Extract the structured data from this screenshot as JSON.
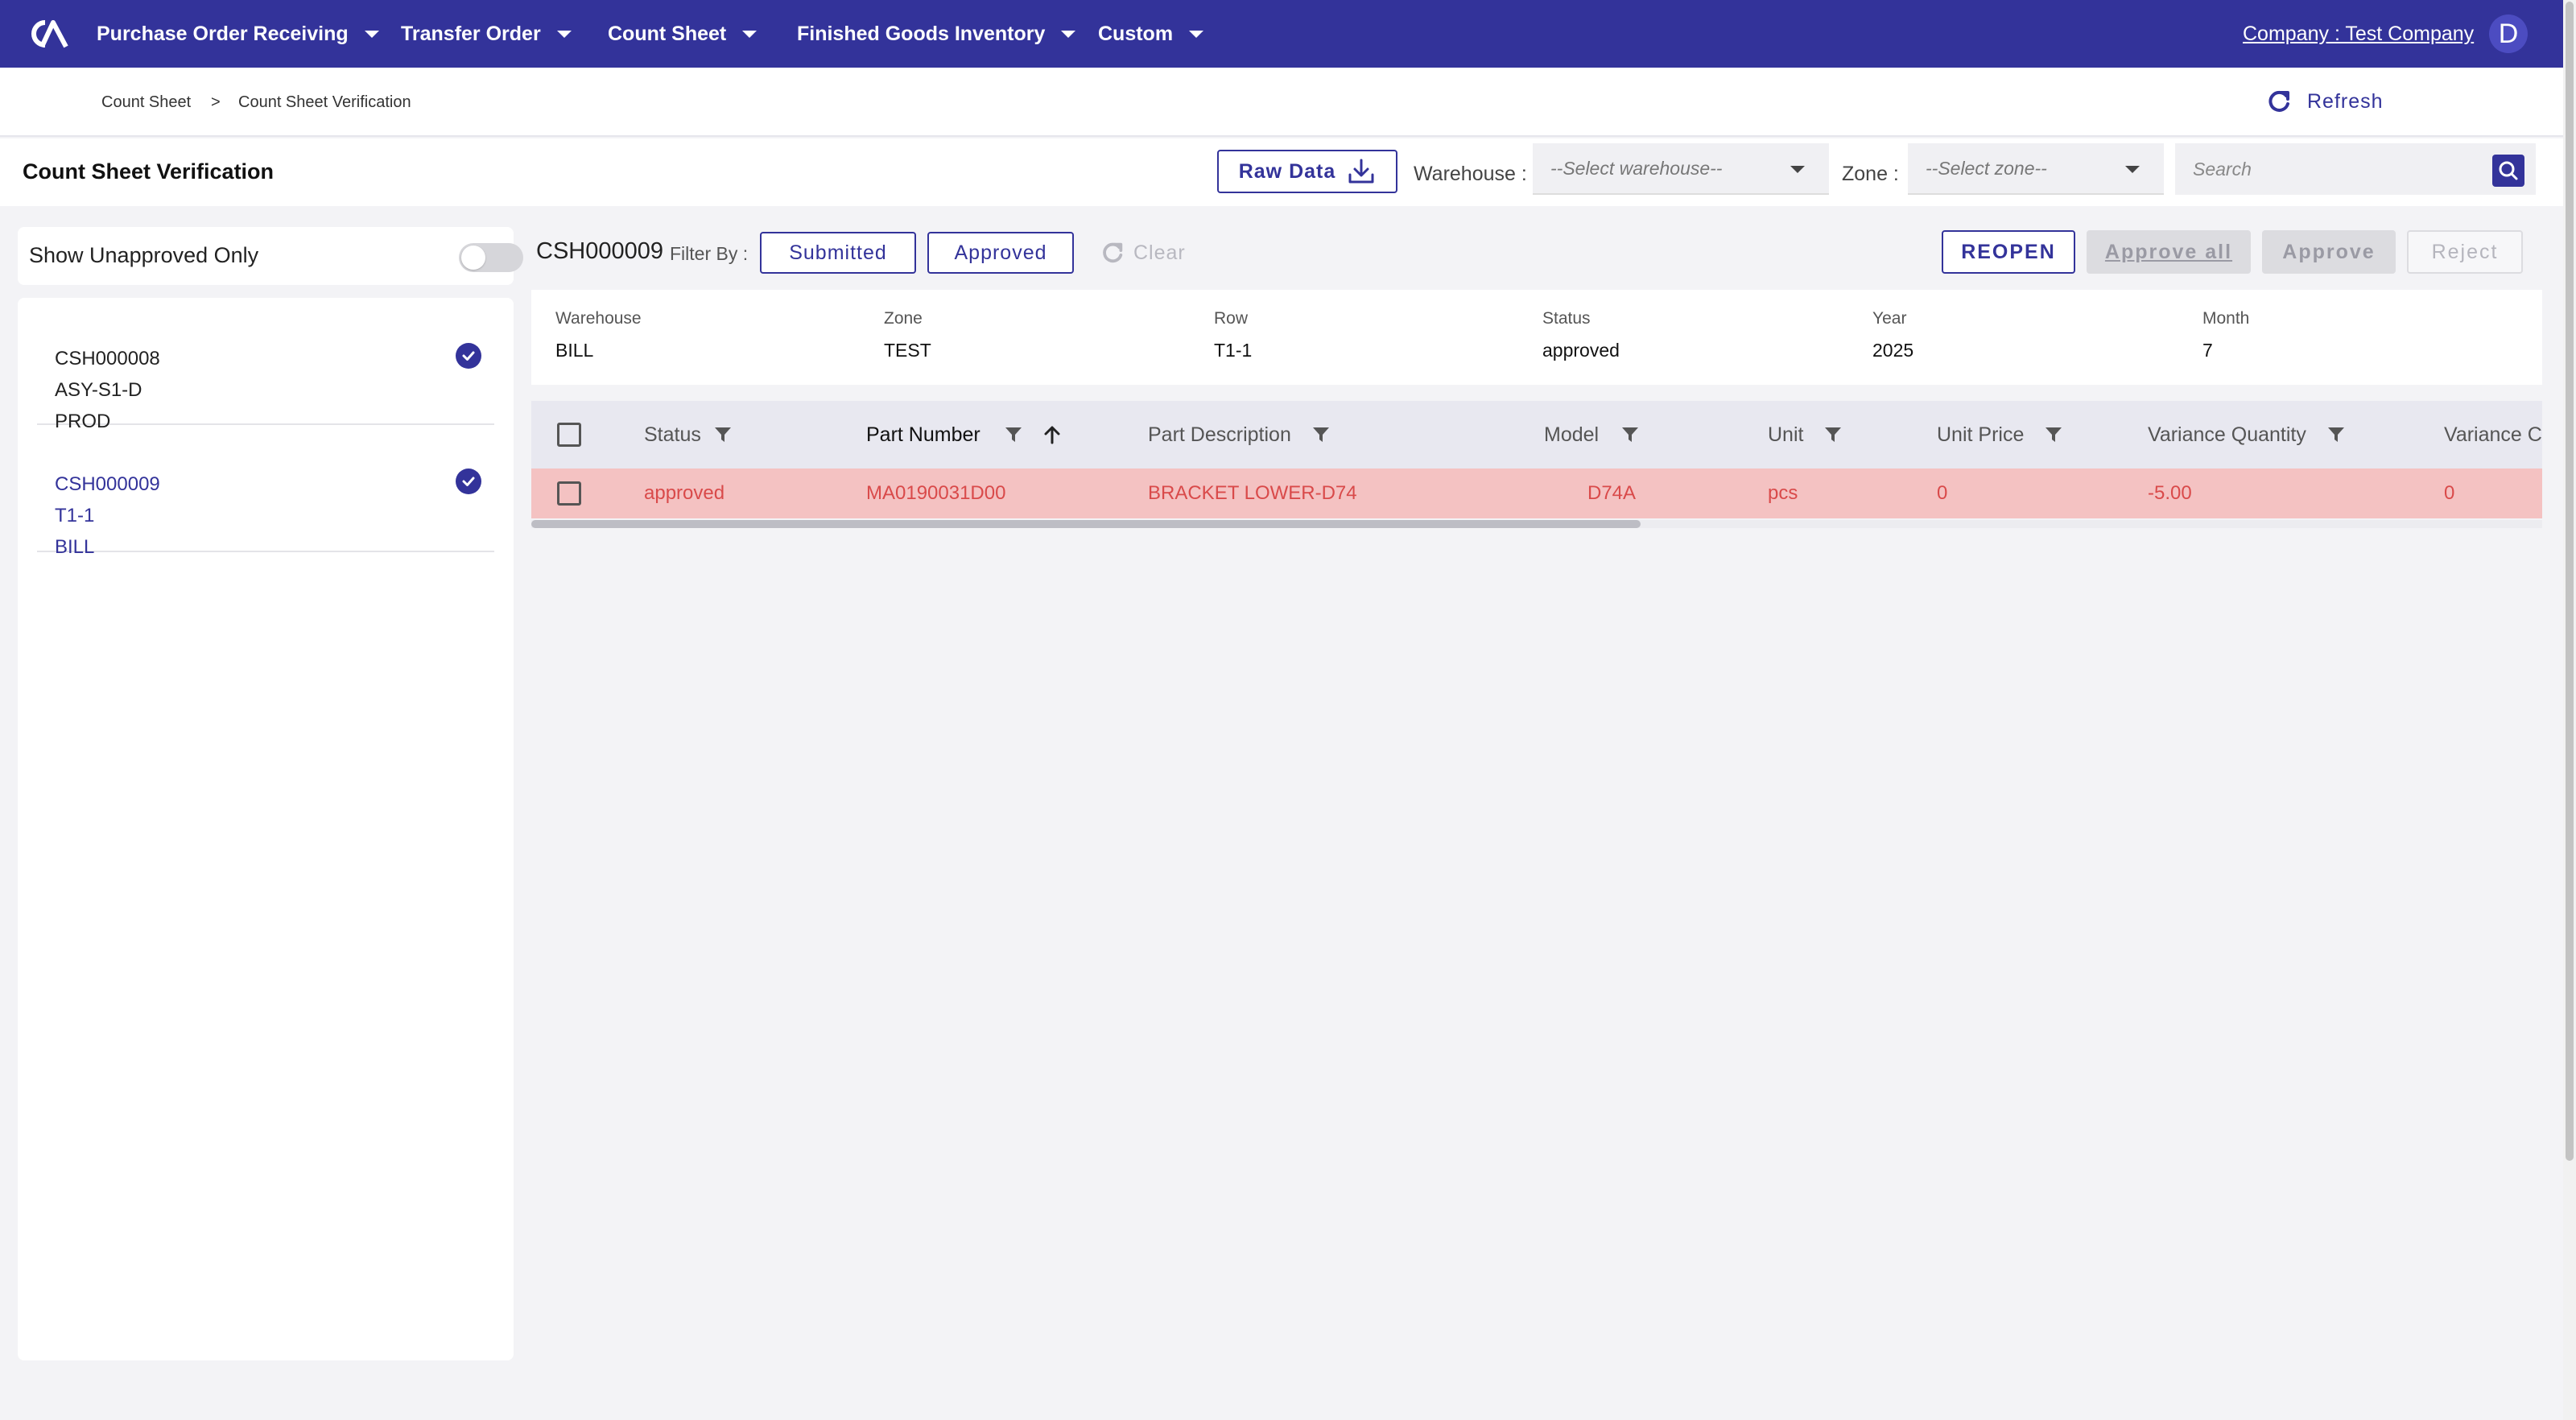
{
  "nav": {
    "items": [
      "Purchase Order Receiving",
      "Transfer Order",
      "Count Sheet",
      "Finished Goods Inventory",
      "Custom"
    ],
    "company": "Company : Test Company",
    "avatar_initial": "D",
    "brand_color": "#33339a"
  },
  "breadcrumb": {
    "first": "Count Sheet",
    "separator": ">",
    "current": "Count Sheet Verification"
  },
  "refresh_label": "Refresh",
  "page_title": "Count Sheet Verification",
  "toolbar": {
    "raw_data_label": "Raw Data",
    "warehouse_label": "Warehouse :",
    "warehouse_placeholder": "--Select warehouse--",
    "zone_label": "Zone :",
    "zone_placeholder": "--Select zone--",
    "search_placeholder": "Search"
  },
  "sidebar": {
    "toggle_label": "Show Unapproved Only",
    "toggle_on": false,
    "sheets": [
      {
        "id": "CSH000008",
        "row": "ASY-S1-D",
        "warehouse": "PROD",
        "checked": true,
        "active": false
      },
      {
        "id": "CSH000009",
        "row": "T1-1",
        "warehouse": "BILL",
        "checked": true,
        "active": true
      }
    ]
  },
  "detail": {
    "sheet_id": "CSH000009",
    "filter_by_label": "Filter By :",
    "filter_submitted": "Submitted",
    "filter_approved": "Approved",
    "clear_label": "Clear",
    "reopen_label": "REOPEN",
    "approve_all_label": "Approve all",
    "approve_label": "Approve",
    "reject_label": "Reject",
    "info": {
      "warehouse_key": "Warehouse",
      "warehouse": "BILL",
      "zone_key": "Zone",
      "zone": "TEST",
      "row_key": "Row",
      "row": "T1-1",
      "status_key": "Status",
      "status": "approved",
      "year_key": "Year",
      "year": "2025",
      "month_key": "Month",
      "month": "7"
    }
  },
  "table": {
    "headers": {
      "status": "Status",
      "part_number": "Part Number",
      "part_description": "Part Description",
      "model": "Model",
      "unit": "Unit",
      "unit_price": "Unit Price",
      "variance_quantity": "Variance Quantity",
      "variance_cost": "Variance Co"
    },
    "rows": [
      {
        "status": "approved",
        "part_number": "MA0190031D00",
        "part_description": "BRACKET LOWER-D74",
        "model": "D74A",
        "unit": "pcs",
        "unit_price": "0",
        "variance_quantity": "-5.00",
        "variance_cost": "0"
      }
    ],
    "row_color": "#f4c2c2",
    "row_text_color": "#d94a4a"
  }
}
